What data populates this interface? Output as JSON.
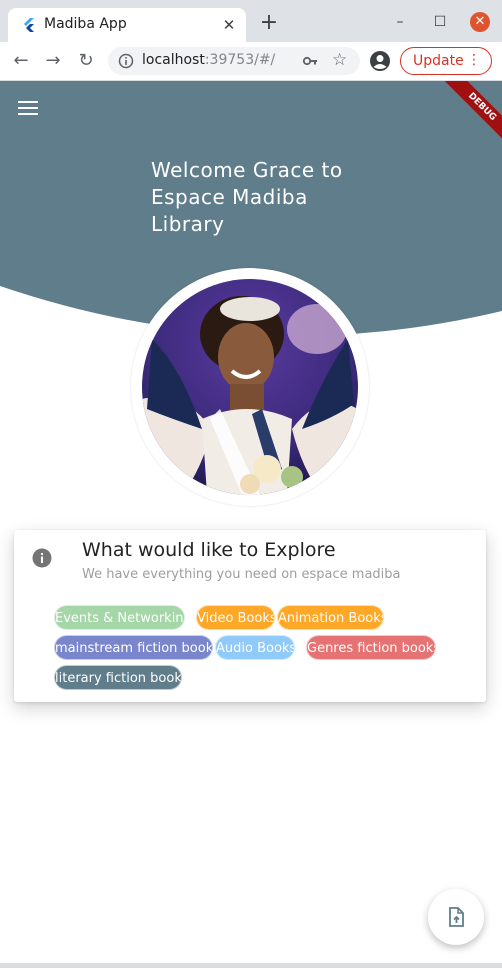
{
  "browser": {
    "tab_title": "Madiba App",
    "url_host": "localhost",
    "url_rest": ":39753/#/",
    "update_label": "Update"
  },
  "app": {
    "welcome": "Welcome Grace to Espace Madiba Library",
    "debug_banner": "DEBUG",
    "header_color": "#607d8b",
    "explore": {
      "title": "What would like to Explore",
      "subtitle": "We have everything you need on espace madiba",
      "chips": [
        {
          "label": "Events & Networking",
          "color": "#a5d6a7"
        },
        {
          "label": "Video Books",
          "color": "#ffa726"
        },
        {
          "label": "Animation Books",
          "color": "#ffa726"
        },
        {
          "label": "mainstream fiction books",
          "color": "#7986cb"
        },
        {
          "label": "Audio Books",
          "color": "#90caf9"
        },
        {
          "label": "Genres fiction books",
          "color": "#e57373"
        },
        {
          "label": "literary fiction books",
          "color": "#607d8b"
        }
      ]
    }
  }
}
